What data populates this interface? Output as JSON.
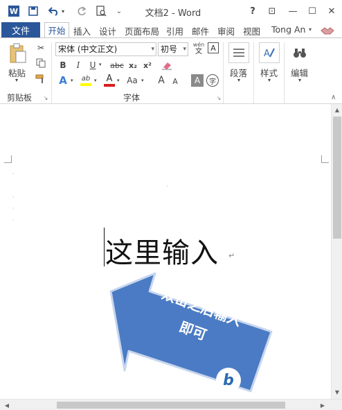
{
  "window": {
    "title": "文档2 - Word",
    "controls": {
      "help": "?",
      "ribbon_display": "⊡",
      "minimize": "—",
      "maximize": "☐",
      "close": "✕"
    }
  },
  "qat": {
    "app_icon": "W",
    "save_icon": "save-icon",
    "undo_icon": "undo-icon",
    "redo_icon": "redo-icon",
    "preview_icon": "print-preview-icon",
    "more": "⌄"
  },
  "tabs": {
    "file": "文件",
    "items": [
      "开始",
      "插入",
      "设计",
      "页面布局",
      "引用",
      "邮件",
      "审阅",
      "视图"
    ],
    "active": "开始",
    "user": "Tong An"
  },
  "ribbon": {
    "clipboard": {
      "paste": "粘贴",
      "label": "剪贴板"
    },
    "font": {
      "font_name": "宋体 (中文正文)",
      "font_size": "初号",
      "wen": "wén",
      "wen_char": "文",
      "a_box": "A",
      "bold": "B",
      "italic": "I",
      "underline": "U",
      "strike": "abc",
      "subscript": "x₂",
      "superscript": "x²",
      "text_effects": "A",
      "highlight": "ab",
      "font_color": "A",
      "change_case": "Aa",
      "grow": "A",
      "shrink": "A",
      "char_shading": "A",
      "enclose": "字",
      "label": "字体"
    },
    "paragraph": {
      "label": "段落"
    },
    "styles": {
      "label": "样式"
    },
    "editing": {
      "label": "编辑"
    }
  },
  "document": {
    "text": "这里输入",
    "paragraph_mark": "↵"
  },
  "callout": {
    "line1": "双击之后输入",
    "line2": "即可"
  },
  "colors": {
    "accent": "#2b579a",
    "callout": "#4a7bc4",
    "callout_border": "#c8d6ee"
  }
}
